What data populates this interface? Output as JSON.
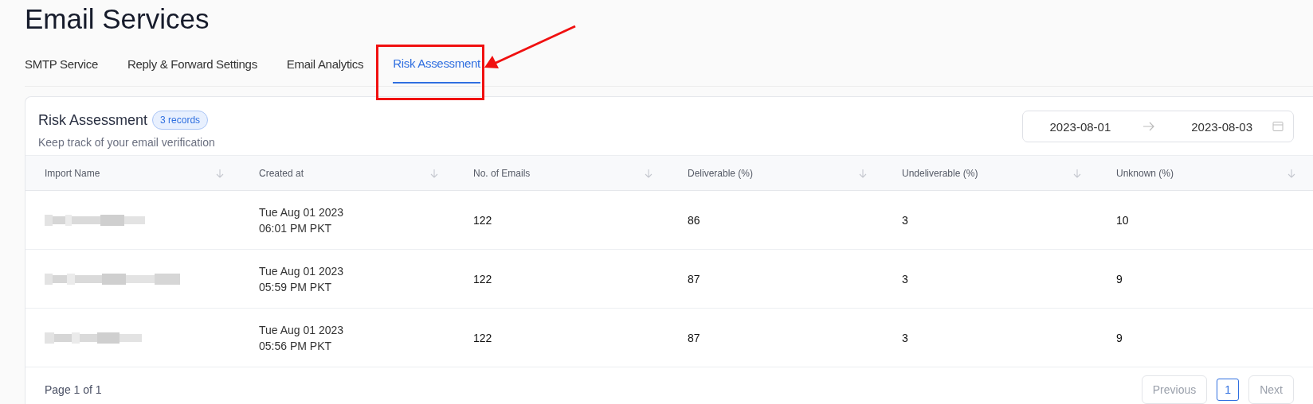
{
  "page": {
    "title": "Email Services"
  },
  "tabs": [
    {
      "label": "SMTP Service",
      "selected": false
    },
    {
      "label": "Reply & Forward Settings",
      "selected": false
    },
    {
      "label": "Email Analytics",
      "selected": false
    },
    {
      "label": "Risk Assessment",
      "selected": true
    }
  ],
  "card": {
    "title": "Risk Assessment",
    "badge": "3 records",
    "subtitle": "Keep track of your email verification",
    "date_range": {
      "start": "2023-08-01",
      "end": "2023-08-03"
    }
  },
  "table": {
    "columns": [
      "Import Name",
      "Created at",
      "No. of Emails",
      "Deliverable (%)",
      "Undeliverable (%)",
      "Unknown (%)"
    ],
    "rows": [
      {
        "created_date": "Tue Aug 01 2023",
        "created_time": "06:01 PM PKT",
        "emails": "122",
        "deliverable": "86",
        "undeliverable": "3",
        "unknown": "10"
      },
      {
        "created_date": "Tue Aug 01 2023",
        "created_time": "05:59 PM PKT",
        "emails": "122",
        "deliverable": "87",
        "undeliverable": "3",
        "unknown": "9"
      },
      {
        "created_date": "Tue Aug 01 2023",
        "created_time": "05:56 PM PKT",
        "emails": "122",
        "deliverable": "87",
        "undeliverable": "3",
        "unknown": "9"
      }
    ]
  },
  "pagination": {
    "summary": "Page 1 of 1",
    "previous": "Previous",
    "pages": [
      {
        "label": "1",
        "selected": true
      }
    ],
    "next": "Next"
  }
}
